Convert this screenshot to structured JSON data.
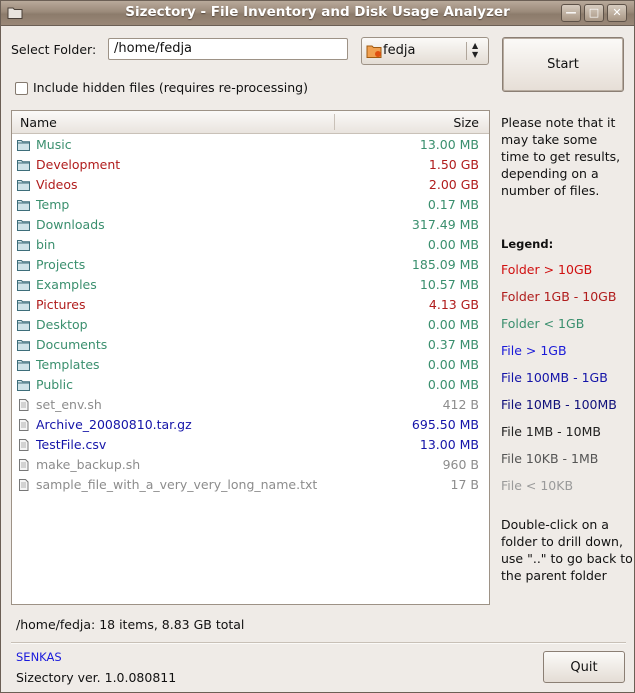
{
  "window": {
    "title": "Sizectory - File Inventory and Disk Usage Analyzer",
    "min_glyph": "—",
    "max_glyph": "□",
    "close_glyph": "✕"
  },
  "folder": {
    "label": "Select Folder:",
    "path_value": "/home/fedja",
    "combo_value": "fedja"
  },
  "start_label": "Start",
  "hidden_files_label": "Include hidden files (requires re-processing)",
  "hidden_files_checked": false,
  "list": {
    "col_name": "Name",
    "col_size": "Size",
    "rows": [
      {
        "name": "Music",
        "size": "13.00 MB",
        "kind": "folder",
        "color": "#3a8f6e"
      },
      {
        "name": "Development",
        "size": "1.50 GB",
        "kind": "folder",
        "color": "#b01c1c"
      },
      {
        "name": "Videos",
        "size": "2.00 GB",
        "kind": "folder",
        "color": "#b01c1c"
      },
      {
        "name": "Temp",
        "size": "0.17 MB",
        "kind": "folder",
        "color": "#3a8f6e"
      },
      {
        "name": "Downloads",
        "size": "317.49 MB",
        "kind": "folder",
        "color": "#3a8f6e"
      },
      {
        "name": "bin",
        "size": "0.00 MB",
        "kind": "folder",
        "color": "#3a8f6e"
      },
      {
        "name": "Projects",
        "size": "185.09 MB",
        "kind": "folder",
        "color": "#3a8f6e"
      },
      {
        "name": "Examples",
        "size": "10.57 MB",
        "kind": "folder",
        "color": "#3a8f6e"
      },
      {
        "name": "Pictures",
        "size": "4.13 GB",
        "kind": "folder",
        "color": "#b01c1c"
      },
      {
        "name": "Desktop",
        "size": "0.00 MB",
        "kind": "folder",
        "color": "#3a8f6e"
      },
      {
        "name": "Documents",
        "size": "0.37 MB",
        "kind": "folder",
        "color": "#3a8f6e"
      },
      {
        "name": "Templates",
        "size": "0.00 MB",
        "kind": "folder",
        "color": "#3a8f6e"
      },
      {
        "name": "Public",
        "size": "0.00 MB",
        "kind": "folder",
        "color": "#3a8f6e"
      },
      {
        "name": "set_env.sh",
        "size": "412 B",
        "kind": "file",
        "color": "#8c8c8c"
      },
      {
        "name": "Archive_20080810.tar.gz",
        "size": "695.50 MB",
        "kind": "file",
        "color": "#1414a8"
      },
      {
        "name": "TestFile.csv",
        "size": "13.00 MB",
        "kind": "file",
        "color": "#1414a8"
      },
      {
        "name": "make_backup.sh",
        "size": "960 B",
        "kind": "file",
        "color": "#8c8c8c"
      },
      {
        "name": "sample_file_with_a_very_very_long_name.txt",
        "size": "17 B",
        "kind": "file",
        "color": "#8c8c8c"
      }
    ]
  },
  "note": "Please note that it may take some time to get results, depending on a number of files.",
  "legend": {
    "title": "Legend:",
    "items": [
      {
        "label": "Folder > 10GB",
        "color": "#d01010"
      },
      {
        "label": "Folder 1GB - 10GB",
        "color": "#b01c1c"
      },
      {
        "label": "Folder < 1GB",
        "color": "#3a8f6e"
      },
      {
        "label": "File > 1GB",
        "color": "#1a1ad8"
      },
      {
        "label": "File 100MB - 1GB",
        "color": "#1414a8"
      },
      {
        "label": "File 10MB - 100MB",
        "color": "#10107a"
      },
      {
        "label": "File 1MB - 10MB",
        "color": "#222222"
      },
      {
        "label": "File 10KB - 1MB",
        "color": "#555555"
      },
      {
        "label": "File < 10KB",
        "color": "#9a9a9a"
      }
    ]
  },
  "help": "Double-click on a folder to drill down, use \"..\" to go back to the parent folder",
  "status": "/home/fedja: 18 items, 8.83 GB total",
  "footer": {
    "brand": "SENKAS",
    "version": "Sizectory ver.  1.0.080811",
    "quit_label": "Quit"
  }
}
